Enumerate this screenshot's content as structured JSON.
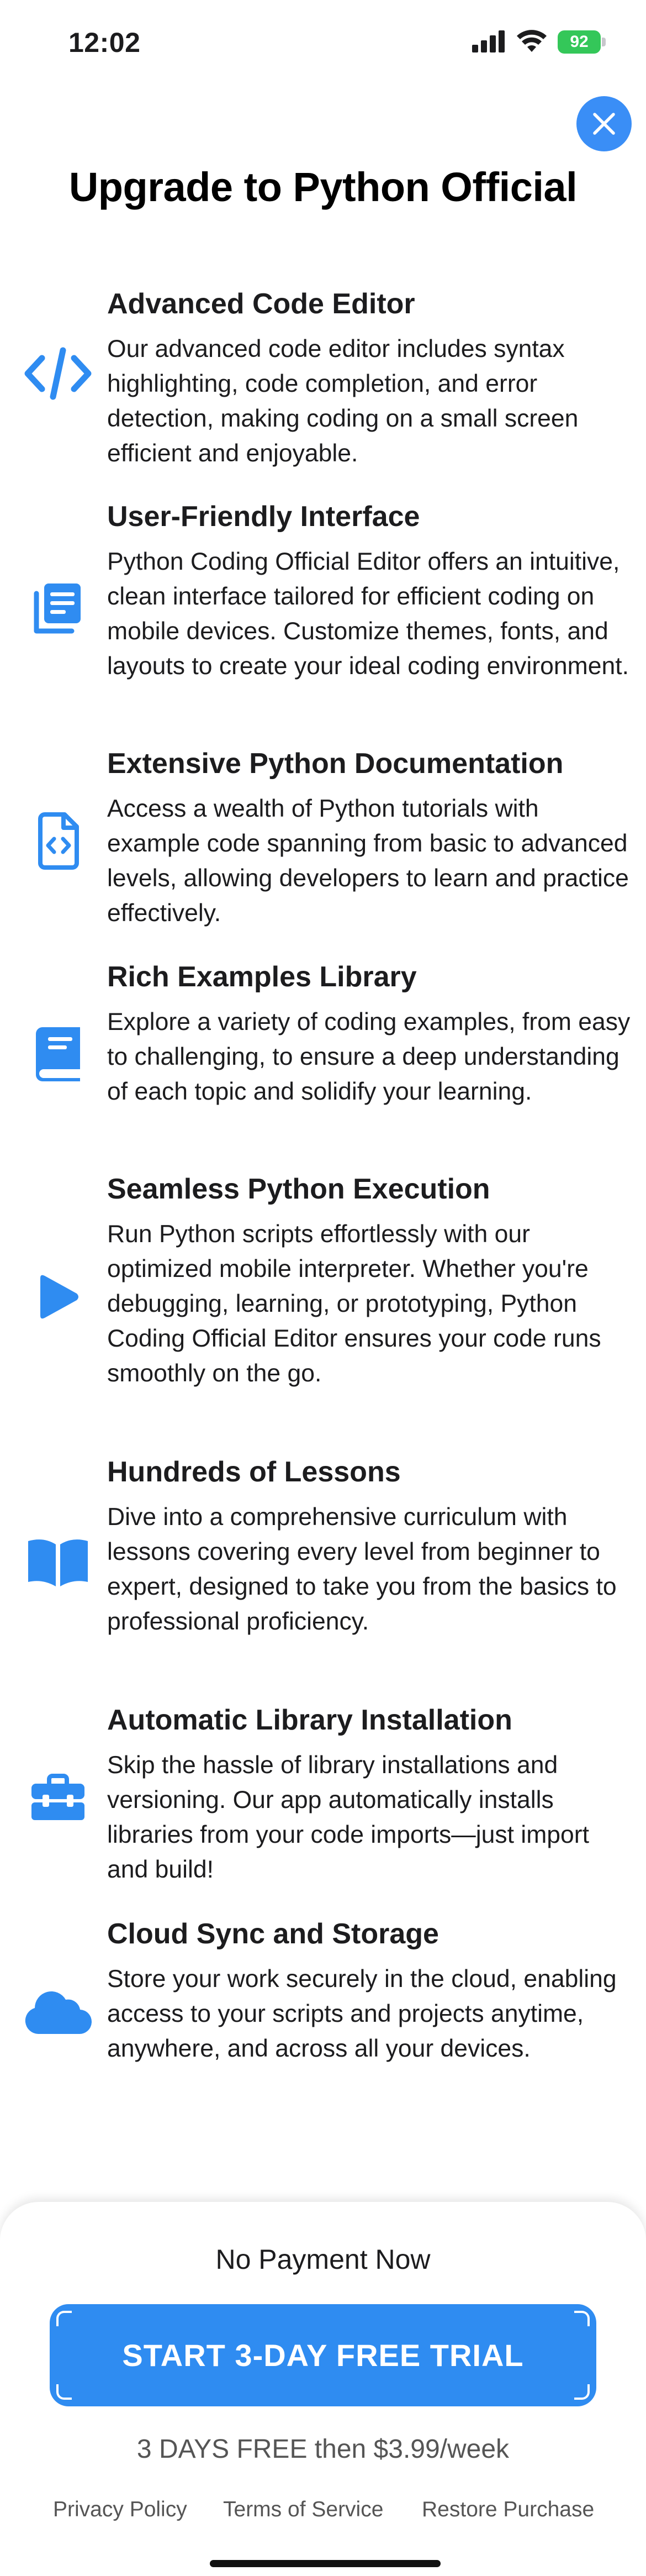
{
  "status_bar": {
    "time": "12:02",
    "battery": "92"
  },
  "page_title": "Upgrade to Python Official",
  "features": [
    {
      "icon": "code-icon",
      "title": "Advanced Code Editor",
      "description": "Our advanced code editor includes syntax highlighting, code completion, and error detection, making coding on a small screen efficient and enjoyable."
    },
    {
      "icon": "interface-icon",
      "title": "User-Friendly Interface",
      "description": "Python Coding Official Editor offers an intuitive, clean interface tailored for efficient coding on mobile devices. Customize themes, fonts, and layouts to create your ideal coding environment."
    },
    {
      "icon": "code-file-icon",
      "title": "Extensive Python Documentation",
      "description": "Access a wealth of Python tutorials with example code spanning from basic to advanced levels, allowing developers to learn and practice effectively."
    },
    {
      "icon": "book-icon",
      "title": "Rich Examples Library",
      "description": "Explore a variety of coding examples, from easy to challenging, to ensure a deep understanding of each topic and solidify your learning."
    },
    {
      "icon": "play-icon",
      "title": "Seamless Python Execution",
      "description": "Run Python scripts effortlessly with our optimized mobile interpreter. Whether you're debugging, learning, or prototyping, Python Coding Official Editor ensures your code runs smoothly on the go."
    },
    {
      "icon": "open-book-icon",
      "title": "Hundreds of Lessons",
      "description": "Dive into a comprehensive curriculum with lessons covering every level from beginner to expert, designed to take you from the basics to professional proficiency."
    },
    {
      "icon": "toolbox-icon",
      "title": "Automatic Library Installation",
      "description": "Skip the hassle of library installations and versioning. Our app automatically installs libraries from your code imports—just import and build!"
    },
    {
      "icon": "cloud-icon",
      "title": "Cloud Sync and Storage",
      "description": "Store your work securely in the cloud, enabling access to your scripts and projects anytime, anywhere, and across all your devices."
    }
  ],
  "paywall": {
    "no_payment": "No Payment Now",
    "cta": "START 3-DAY FREE TRIAL",
    "price_note": "3 DAYS FREE then $3.99/week",
    "links": {
      "privacy": "Privacy Policy",
      "terms": "Terms of Service",
      "restore": "Restore Purchase"
    }
  },
  "colors": {
    "accent": "#2f8cf1",
    "battery": "#34c759",
    "text": "#1c1c1e",
    "muted": "#555555"
  }
}
